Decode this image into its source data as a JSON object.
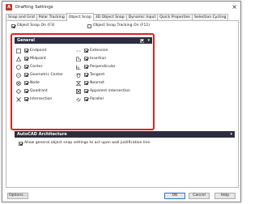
{
  "window": {
    "title": "Drafting Settings"
  },
  "tabs": [
    {
      "label": "Snap and Grid"
    },
    {
      "label": "Polar Tracking"
    },
    {
      "label": "Object Snap"
    },
    {
      "label": "3D Object Snap"
    },
    {
      "label": "Dynamic Input"
    },
    {
      "label": "Quick Properties"
    },
    {
      "label": "Selection Cycling"
    }
  ],
  "active_tab": "Object Snap",
  "top_options": [
    {
      "label": "Object Snap On (F3)",
      "checked": true
    },
    {
      "label": "Object Snap Tracking On (F11)",
      "checked": false
    }
  ],
  "general": {
    "title": "General",
    "left": [
      {
        "label": "Endpoint",
        "checked": true,
        "icon": "endpoint-icon"
      },
      {
        "label": "Midpoint",
        "checked": true,
        "icon": "midpoint-icon"
      },
      {
        "label": "Center",
        "checked": true,
        "icon": "center-icon"
      },
      {
        "label": "Geometric Center",
        "checked": true,
        "icon": "geometric-center-icon"
      },
      {
        "label": "Node",
        "checked": true,
        "icon": "node-icon"
      },
      {
        "label": "Quadrant",
        "checked": true,
        "icon": "quadrant-icon"
      },
      {
        "label": "Intersection",
        "checked": true,
        "icon": "intersection-icon"
      }
    ],
    "right": [
      {
        "label": "Extension",
        "checked": true,
        "icon": "extension-icon"
      },
      {
        "label": "Insertion",
        "checked": true,
        "icon": "insertion-icon"
      },
      {
        "label": "Perpendicular",
        "checked": true,
        "icon": "perpendicular-icon"
      },
      {
        "label": "Tangent",
        "checked": true,
        "icon": "tangent-icon"
      },
      {
        "label": "Nearest",
        "checked": true,
        "icon": "nearest-icon"
      },
      {
        "label": "Apparent intersection",
        "checked": true,
        "icon": "apparent-intersection-icon"
      },
      {
        "label": "Parallel",
        "checked": true,
        "icon": "parallel-icon"
      }
    ]
  },
  "autocad": {
    "title": "AutoCAD Architecture",
    "option_label": "Allow general object snap settings to act upon wall justification line",
    "option_checked": true
  },
  "buttons": {
    "options": "Options...",
    "ok": "OK",
    "cancel": "Cancel",
    "help": "Help"
  },
  "colors": {
    "highlight": "#e02020",
    "section_header": "#2d2d40",
    "ok_border": "#2a7ad8"
  }
}
